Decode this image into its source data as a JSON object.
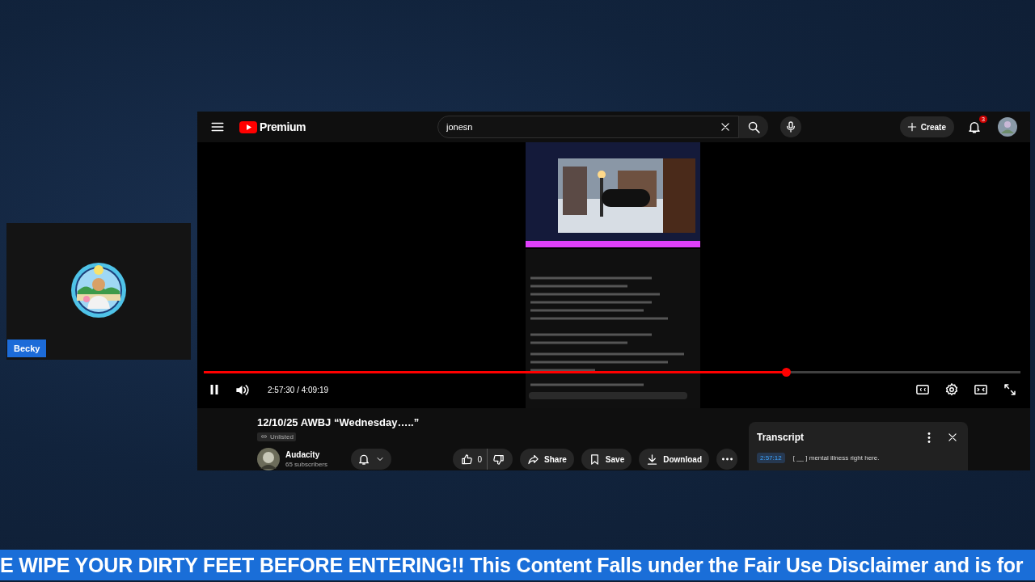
{
  "camera_tile": {
    "name": "Becky"
  },
  "youtube": {
    "header": {
      "logo": "Premium",
      "search": {
        "value": "jonesn"
      },
      "create": "Create",
      "notifications": "3"
    },
    "player": {
      "playing": true,
      "progress": {
        "level": 0.713
      },
      "time": "2:57:30 / 4:09:19"
    },
    "video_info": {
      "title": "12/10/25 AWBJ “Wednesday…..”",
      "visibility": "Unlisted",
      "channel": {
        "name": "Audacity",
        "subscribers": "65 subscribers"
      },
      "likes": "0",
      "actions": [
        "Share",
        "Save",
        "Download"
      ]
    },
    "transcript": {
      "title": "Transcript",
      "segments": [
        {
          "time": "2:57:12",
          "text": "[ __ ] mental illness right here."
        }
      ]
    }
  },
  "ticker": {
    "text": "E WIPE YOUR DIRTY FEET BEFORE ENTERING!! This Content Falls under the Fair Use Disclaimer and is for"
  }
}
